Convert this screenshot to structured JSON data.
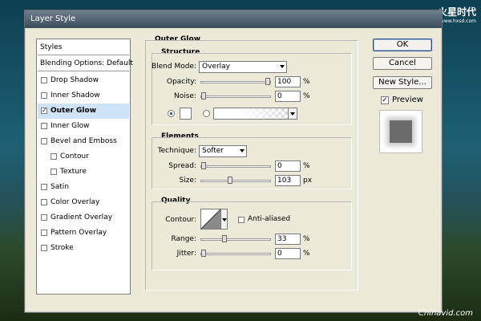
{
  "window": {
    "title": "Layer Style"
  },
  "watermark_top": {
    "main": "火星时代",
    "sub": "www.hxsd.com"
  },
  "watermark_bottom": "Chinavid.com",
  "styles_list": [
    {
      "label": "Styles",
      "type": "header"
    },
    {
      "label": "Blending Options: Default",
      "type": "header"
    },
    {
      "label": "Drop Shadow",
      "checked": false
    },
    {
      "label": "Inner Shadow",
      "checked": false
    },
    {
      "label": "Outer Glow",
      "checked": true,
      "selected": true
    },
    {
      "label": "Inner Glow",
      "checked": false
    },
    {
      "label": "Bevel and Emboss",
      "checked": false
    },
    {
      "label": "Contour",
      "checked": false,
      "indent": true
    },
    {
      "label": "Texture",
      "checked": false,
      "indent": true
    },
    {
      "label": "Satin",
      "checked": false
    },
    {
      "label": "Color Overlay",
      "checked": false
    },
    {
      "label": "Gradient Overlay",
      "checked": false
    },
    {
      "label": "Pattern Overlay",
      "checked": false
    },
    {
      "label": "Stroke",
      "checked": false
    }
  ],
  "outer_glow": {
    "title": "Outer Glow",
    "structure": {
      "title": "Structure",
      "blend_mode_label": "Blend Mode:",
      "blend_mode_value": "Overlay",
      "opacity_label": "Opacity:",
      "opacity_value": "100",
      "opacity_level": 1.0,
      "noise_label": "Noise:",
      "noise_value": "0",
      "noise_level": 0.0,
      "unit": "%"
    },
    "elements": {
      "title": "Elements",
      "technique_label": "Technique:",
      "technique_value": "Softer",
      "spread_label": "Spread:",
      "spread_value": "0",
      "spread_level": 0.0,
      "size_label": "Size:",
      "size_value": "103",
      "size_level": 0.41,
      "size_unit": "px",
      "unit": "%"
    },
    "quality": {
      "title": "Quality",
      "contour_label": "Contour:",
      "anti_aliased_label": "Anti-aliased",
      "anti_aliased_checked": false,
      "range_label": "Range:",
      "range_value": "33",
      "range_level": 0.33,
      "jitter_label": "Jitter:",
      "jitter_value": "0",
      "jitter_level": 0.0,
      "unit": "%"
    }
  },
  "buttons": {
    "ok": "OK",
    "cancel": "Cancel",
    "new_style": "New Style..."
  },
  "preview": {
    "label": "Preview",
    "checked": true
  },
  "colors": {
    "selected_row": "#cfe3f6",
    "dialog_bg": "#ece9d8"
  }
}
